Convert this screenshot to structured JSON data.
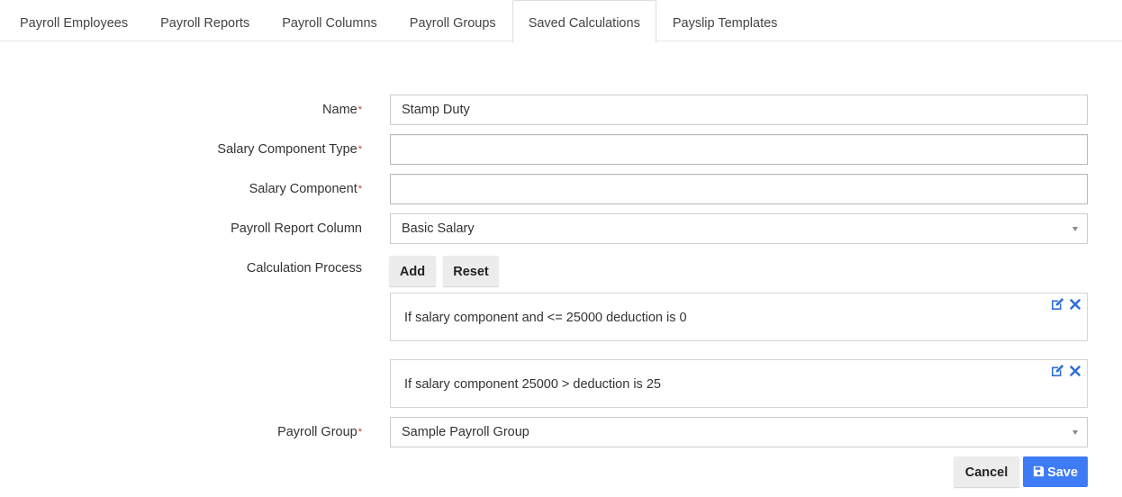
{
  "tabs": [
    {
      "label": "Payroll Employees",
      "active": false
    },
    {
      "label": "Payroll Reports",
      "active": false
    },
    {
      "label": "Payroll Columns",
      "active": false
    },
    {
      "label": "Payroll Groups",
      "active": false
    },
    {
      "label": "Saved Calculations",
      "active": true
    },
    {
      "label": "Payslip Templates",
      "active": false
    }
  ],
  "form": {
    "name": {
      "label": "Name",
      "required_mark": "*",
      "value": "Stamp Duty"
    },
    "salary_component_type": {
      "label": "Salary Component Type",
      "required_mark": "*",
      "value": ""
    },
    "salary_component": {
      "label": "Salary Component",
      "required_mark": "*",
      "value": ""
    },
    "payroll_report_column": {
      "label": "Payroll Report Column",
      "value": "Basic Salary"
    },
    "calculation_process": {
      "label": "Calculation Process",
      "add_label": "Add",
      "reset_label": "Reset",
      "items": [
        {
          "text": "If salary component and <= 25000 deduction is 0"
        },
        {
          "text": "If salary component 25000 > deduction is 25"
        }
      ]
    },
    "payroll_group": {
      "label": "Payroll Group",
      "required_mark": "*",
      "value": "Sample Payroll Group"
    }
  },
  "actions": {
    "cancel_label": "Cancel",
    "save_label": "Save"
  },
  "icons": {
    "edit": "edit-icon",
    "delete": "close-icon",
    "save": "floppy-disk-icon",
    "dropdown": "caret-down-icon"
  },
  "colors": {
    "accent": "#3d7cf4",
    "icon_blue": "#2f6fd6",
    "required": "#c0392b"
  }
}
